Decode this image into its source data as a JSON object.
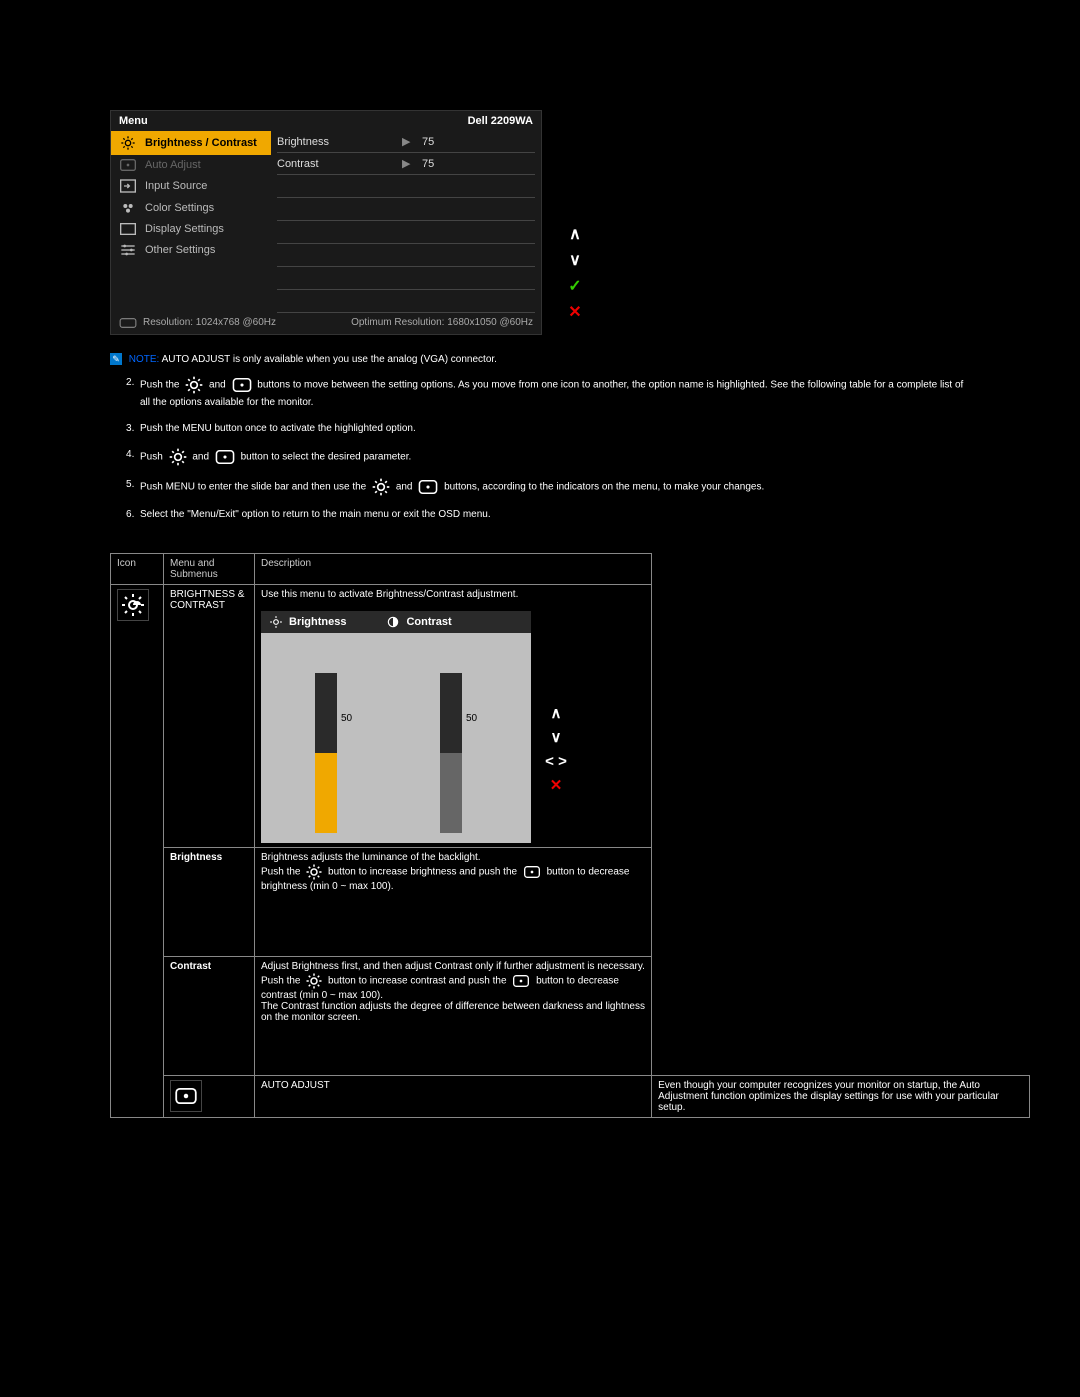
{
  "osd": {
    "title_left": "Menu",
    "title_right": "Dell 2209WA",
    "menu": [
      {
        "icon": "brightness-icon",
        "label": "Brightness / Contrast",
        "state": "active"
      },
      {
        "icon": "auto-adjust-icon",
        "label": "Auto Adjust",
        "state": "dim"
      },
      {
        "icon": "input-source-icon",
        "label": "Input Source",
        "state": ""
      },
      {
        "icon": "color-settings-icon",
        "label": "Color Settings",
        "state": ""
      },
      {
        "icon": "display-settings-icon",
        "label": "Display Settings",
        "state": ""
      },
      {
        "icon": "other-settings-icon",
        "label": "Other Settings",
        "state": ""
      }
    ],
    "rows": [
      {
        "label": "Brightness",
        "value": "75"
      },
      {
        "label": "Contrast",
        "value": "75"
      }
    ],
    "foot_left": "Resolution: 1024x768 @60Hz",
    "foot_right": "Optimum Resolution: 1680x1050 @60Hz"
  },
  "note": {
    "label": "NOTE:",
    "body": "AUTO ADJUST is only available when you use the analog (VGA) connector."
  },
  "steps": {
    "s2a": "Push the ",
    "s2b": " and ",
    "s2c": " buttons to move between the setting options. As you move from one icon to another, the option name is highlighted. See the following table for a complete list of all the options available for the monitor.",
    "s3": "Push the MENU button once to activate the highlighted option.",
    "s4a": "Push ",
    "s4b": " and ",
    "s4c": " button to select the desired parameter.",
    "s5a": "Push MENU to enter the slide bar and then use the ",
    "s5b": " and ",
    "s5c": " buttons, according to the indicators on the menu, to make your changes.",
    "s6": "Select the \"Menu/Exit\" option to return to the main menu or exit the OSD menu."
  },
  "table": {
    "h_icon": "Icon",
    "h_menu": "Menu and Submenus",
    "h_desc": "Description",
    "r1_menu": "BRIGHTNESS & CONTRAST",
    "r1_desc": "Use this menu to activate Brightness/Contrast adjustment.",
    "bc_header_brightness": "Brightness",
    "bc_header_contrast": "Contrast",
    "bc_val_brightness": "50",
    "bc_val_contrast": "50",
    "r_brightness_menu": "Brightness",
    "r_brightness_line1": "Brightness adjusts the luminance of the backlight.",
    "r_brightness_a": "Push the ",
    "r_brightness_b": " button to increase brightness and push the ",
    "r_brightness_c": " button to decrease brightness (min 0 ~ max 100).",
    "r_contrast_menu": "Contrast",
    "r_contrast_line1": "Adjust Brightness first, and then adjust Contrast only if further adjustment is necessary.",
    "r_contrast_a": "Push the ",
    "r_contrast_b": " button to increase contrast and push the ",
    "r_contrast_c": " button to decrease contrast (min 0 ~ max 100).",
    "r_contrast_line3": "The Contrast function adjusts the degree of difference between darkness and lightness on the monitor screen.",
    "r_auto_menu": "AUTO ADJUST",
    "r_auto_desc": "Even though your computer recognizes your monitor on startup, the Auto Adjustment function optimizes the display settings for use with your particular setup."
  }
}
